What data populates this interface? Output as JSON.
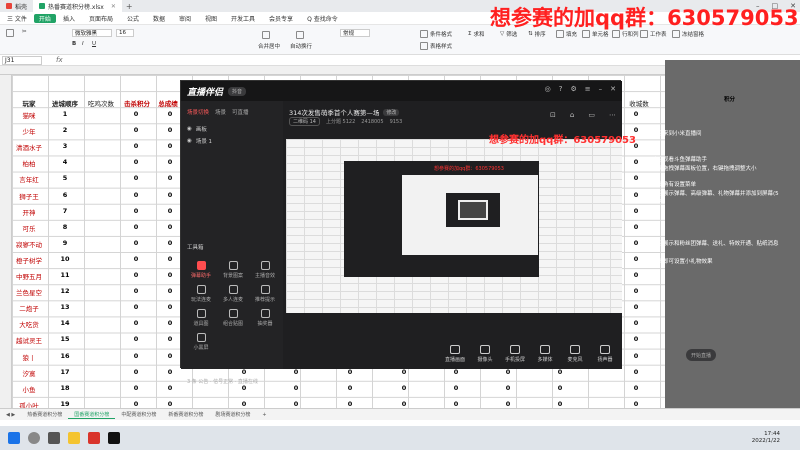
{
  "browser": {
    "tabs": [
      {
        "label": "稻壳",
        "color": "#e8433a"
      },
      {
        "label": "热番赛道积分榜.xlsx",
        "color": "#21a366"
      }
    ]
  },
  "menu": {
    "file": "三 文件",
    "items": [
      "开始",
      "插入",
      "页面布局",
      "公式",
      "数据",
      "审阅",
      "视图",
      "开发工具",
      "会员专享"
    ],
    "active": "开始",
    "search": "Q 查找命令"
  },
  "ribbon": {
    "font": "微软雅黑",
    "size": "16",
    "merge": "合并居中",
    "wrap": "自动换行",
    "format": "常规",
    "items": [
      "格式刷",
      "条件格式",
      "表格样式",
      "求和",
      "筛选",
      "排序",
      "填充",
      "单元格",
      "行和列",
      "工作表",
      "冻结窗格"
    ]
  },
  "formula": {
    "cell": "J31",
    "fx": "fx"
  },
  "sheet": {
    "headers": [
      "玩家",
      "进城顺序",
      "吃鸡次数",
      "击杀积分",
      "总成绩"
    ],
    "header_colors": [
      "#000",
      "#000",
      "#000",
      "#c00000",
      "#c00000"
    ],
    "rows": [
      {
        "name": "猫咪",
        "order": "1"
      },
      {
        "name": "少年",
        "order": "2"
      },
      {
        "name": "清酒水子",
        "order": "3"
      },
      {
        "name": "柏柏",
        "order": "4"
      },
      {
        "name": "言年红",
        "order": "5"
      },
      {
        "name": "狮子王",
        "order": "6"
      },
      {
        "name": "开神",
        "order": "7"
      },
      {
        "name": "可乐",
        "order": "8"
      },
      {
        "name": "寂寥不动",
        "order": "9"
      },
      {
        "name": "橙子树学",
        "order": "10"
      },
      {
        "name": "中野五月",
        "order": "11"
      },
      {
        "name": "兰色星空",
        "order": "12"
      },
      {
        "name": "二炮子",
        "order": "13"
      },
      {
        "name": "大吃货",
        "order": "14"
      },
      {
        "name": "越试灵王",
        "order": "15"
      },
      {
        "name": "狼丨",
        "order": "16"
      },
      {
        "name": "汐寞",
        "order": "17"
      },
      {
        "name": "小鱼",
        "order": "18"
      },
      {
        "name": "孤小叶",
        "order": "19"
      }
    ],
    "zero": "0",
    "extra_header": "收城数",
    "tabs": [
      "热番赛道积分榜",
      "国番赛道积分榜",
      "中配赛道积分榜",
      "新番赛道积分榜",
      "剧场赛道积分榜"
    ]
  },
  "right_panel": {
    "lines": [
      "欢迎来到小米直播间",
      "欢迎观看斗鱼弹幕助手",
      "左键拖拽弹幕面板位置，右键拖拽调整大小",
      "右上角有设置菜单",
      "欢迎展示弹幕、高级弹幕、礼物弹幕并添加到屏幕(5分钟)",
      "欢迎展示和粉丝团弹幕、送礼、特效开通、贴纸消息",
      "点赞即可设置小礼物效果"
    ],
    "header": "积分"
  },
  "app": {
    "logo": "直播伴侣",
    "badge": "抖音",
    "side_tabs": [
      "场景切换",
      "场景",
      "可直播"
    ],
    "scenes": [
      "画板",
      "场景 1"
    ],
    "tools_title": "工具箱",
    "tools": [
      "弹幕助手",
      "背景图案",
      "主播音效",
      "玩法连麦",
      "多人连麦",
      "推荐提示",
      "道具图",
      "组合贴图",
      "抽奖器",
      "小黑屏",
      "",
      ""
    ],
    "footer": "3 条 公告 · 信号正常 · 直播在线",
    "room_title": "314次发售萌季首个人赛第—场",
    "edit": "修改",
    "room_id": "二维码 14",
    "meta1": "上分题 5122",
    "meta2": "2418005",
    "meta3": "9153",
    "bottom": [
      "直播画面",
      "摄像头",
      "手机投屏",
      "多媒体",
      "麦克风",
      "扬声器"
    ],
    "go_live": "开始直播",
    "preview_watermark": "想参赛的加qq群：630579053"
  },
  "watermark": "想参赛的加qq群：630579053",
  "overlay_watermark": "想参赛的加qq群：630579053",
  "taskbar": {
    "time": "17:44",
    "date": "2022/1/22"
  }
}
